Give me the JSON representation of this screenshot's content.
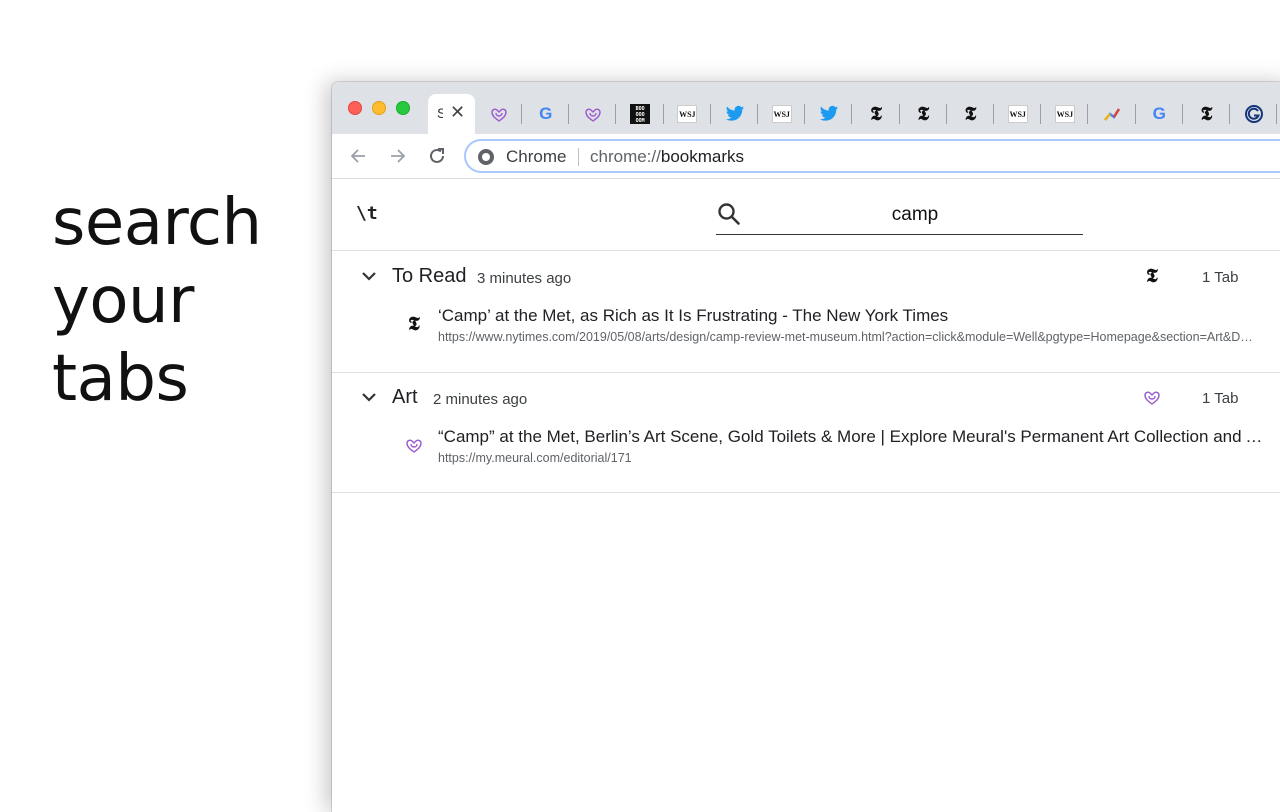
{
  "tagline": {
    "line1": "search",
    "line2": "your",
    "line3": "tabs"
  },
  "browser": {
    "active_tab": {
      "title": "S",
      "close_glyph": "✕"
    },
    "pinned_tabs": [
      {
        "icon": "meural-icon"
      },
      {
        "icon": "google-icon",
        "glyph": "G"
      },
      {
        "icon": "meural-icon"
      },
      {
        "icon": "boooooom-icon",
        "glyph": "BOO OOO OOM"
      },
      {
        "icon": "wsj-icon",
        "glyph": "WSJ"
      },
      {
        "icon": "twitter-icon"
      },
      {
        "icon": "wsj-icon",
        "glyph": "WSJ"
      },
      {
        "icon": "twitter-icon"
      },
      {
        "icon": "nyt-icon",
        "glyph": "𝕿"
      },
      {
        "icon": "nyt-icon",
        "glyph": "𝕿"
      },
      {
        "icon": "nyt-icon",
        "glyph": "𝕿"
      },
      {
        "icon": "wsj-icon",
        "glyph": "WSJ"
      },
      {
        "icon": "wsj-icon",
        "glyph": "WSJ"
      },
      {
        "icon": "analytics-icon"
      },
      {
        "icon": "google-icon",
        "glyph": "G"
      },
      {
        "icon": "nyt-icon",
        "glyph": "𝕿"
      },
      {
        "icon": "grammarly-icon"
      }
    ],
    "omnibox": {
      "site_label": "Chrome",
      "url_scheme": "chrome://",
      "url_path": "bookmarks"
    }
  },
  "app": {
    "logo": "\\t",
    "search": {
      "value": "camp"
    },
    "groups": [
      {
        "title": "To Read",
        "time": "3 minutes ago",
        "count": "1 Tab",
        "icon": "nyt-icon",
        "items": [
          {
            "title": "‘Camp’ at the Met, as Rich as It Is Frustrating - The New York Times",
            "url": "https://www.nytimes.com/2019/05/08/arts/design/camp-review-met-museum.html?action=click&module=Well&pgtype=Homepage&section=Art&Design",
            "icon": "nyt-icon"
          }
        ]
      },
      {
        "title": "Art",
        "time": "2 minutes ago",
        "count": "1 Tab",
        "icon": "meural-icon",
        "items": [
          {
            "title": "“Camp” at the Met, Berlin’s Art Scene, Gold Toilets & More | Explore Meural's Permanent Art Collection and Artist Interviews",
            "url": "https://my.meural.com/editorial/171",
            "icon": "meural-icon"
          }
        ]
      }
    ]
  },
  "colors": {
    "accent": "#a8c7fa",
    "meural": "#9b59d0",
    "twitter": "#1d9bf0",
    "google_blue": "#4285f4"
  }
}
